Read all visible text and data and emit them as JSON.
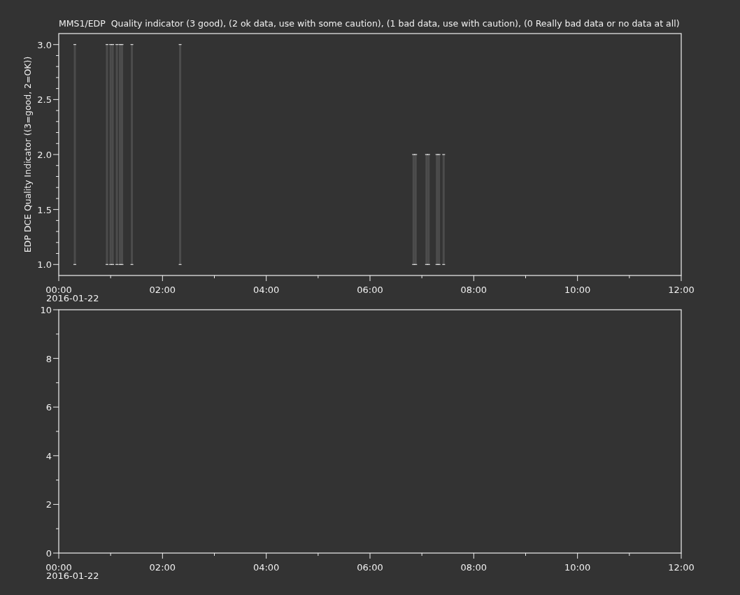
{
  "panels": [
    {
      "date_label": "2016-01-22",
      "chart_data": {
        "type": "area",
        "title": "MMS1/EDP  Quality indicator (3 good), (2 ok data, use with some caution), (1 bad data, use with caution), (0 Really bad data or no data at all)",
        "ylabel": "EDP DCE Quality Indicator ((3=good, 2=OK))",
        "x": [
          0.31,
          0.93,
          1.0,
          1.04,
          1.12,
          1.18,
          1.22,
          1.41,
          2.34,
          6.84,
          6.88,
          7.09,
          7.13,
          7.29,
          7.33,
          7.42
        ],
        "values": [
          3,
          3,
          3,
          3,
          3,
          3,
          3,
          3,
          3,
          2,
          2,
          2,
          2,
          2,
          2,
          2
        ],
        "xlim": [
          0,
          12
        ],
        "ylim": [
          0.9,
          3.1
        ],
        "xticks": [
          {
            "value": 0,
            "label": "00:00"
          },
          {
            "value": 2,
            "label": "02:00"
          },
          {
            "value": 4,
            "label": "04:00"
          },
          {
            "value": 6,
            "label": "06:00"
          },
          {
            "value": 8,
            "label": "08:00"
          },
          {
            "value": 10,
            "label": "10:00"
          },
          {
            "value": 12,
            "label": "12:00"
          }
        ],
        "yticks": [
          {
            "value": 1,
            "label": "1.0"
          },
          {
            "value": 1.5,
            "label": "1.5"
          },
          {
            "value": 2,
            "label": "2.0"
          },
          {
            "value": 2.5,
            "label": "2.5"
          },
          {
            "value": 3,
            "label": "3.0"
          }
        ]
      }
    },
    {
      "date_label": "2016-01-22",
      "chart_data": {
        "type": "line",
        "xlim": [
          0,
          12
        ],
        "ylim": [
          0,
          10
        ],
        "xticks": [
          {
            "value": 0,
            "label": "00:00"
          },
          {
            "value": 2,
            "label": "02:00"
          },
          {
            "value": 4,
            "label": "04:00"
          },
          {
            "value": 6,
            "label": "06:00"
          },
          {
            "value": 8,
            "label": "08:00"
          },
          {
            "value": 10,
            "label": "10:00"
          },
          {
            "value": 12,
            "label": "12:00"
          }
        ],
        "yticks": [
          0,
          2,
          4,
          6,
          8,
          10
        ]
      }
    }
  ]
}
